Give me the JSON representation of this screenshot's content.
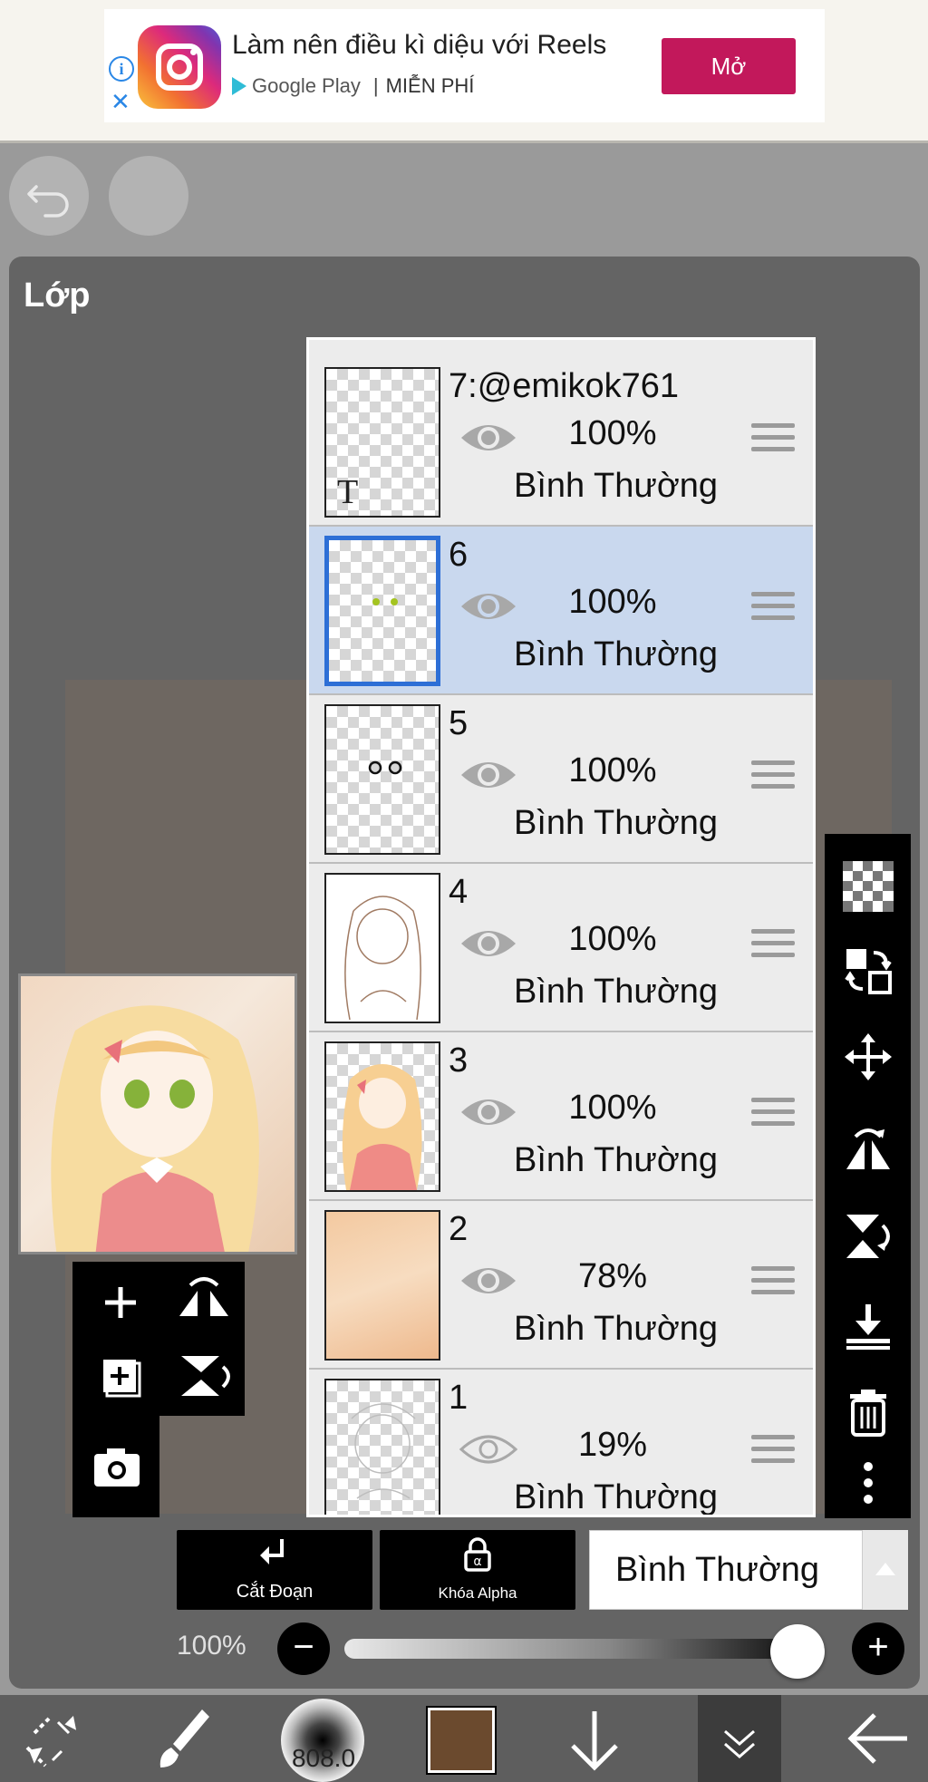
{
  "ad": {
    "title": "Làm nên điều kì diệu với Reels",
    "store": "Google Play",
    "separator": "|",
    "price": "MIỄN PHÍ",
    "cta": "Mở",
    "info_glyph": "i",
    "close_glyph": "✕"
  },
  "panel": {
    "title": "Lớp"
  },
  "layers": [
    {
      "name": "7:@emikok761",
      "opacity": "100%",
      "mode": "Bình Thường",
      "selected": false,
      "visible": true,
      "thumb_glyph": "T"
    },
    {
      "name": "6",
      "opacity": "100%",
      "mode": "Bình Thường",
      "selected": true,
      "visible": true
    },
    {
      "name": "5",
      "opacity": "100%",
      "mode": "Bình Thường",
      "selected": false,
      "visible": true
    },
    {
      "name": "4",
      "opacity": "100%",
      "mode": "Bình Thường",
      "selected": false,
      "visible": true
    },
    {
      "name": "3",
      "opacity": "100%",
      "mode": "Bình Thường",
      "selected": false,
      "visible": true
    },
    {
      "name": "2",
      "opacity": "78%",
      "mode": "Bình Thường",
      "selected": false,
      "visible": true
    },
    {
      "name": "1",
      "opacity": "19%",
      "mode": "Bình Thường",
      "selected": false,
      "visible": false
    }
  ],
  "actions": {
    "clip_label": "Cắt Đoạn",
    "alpha_lock_label": "Khóa Alpha"
  },
  "blend_mode": {
    "selected": "Bình Thường"
  },
  "opacity": {
    "value": "100%",
    "minus": "−",
    "plus": "+",
    "level": 1.0
  },
  "bottom_nav": {
    "brush_size": "808.0"
  },
  "colors": {
    "accent": "#2d6fd6",
    "ad_button": "#c2185b",
    "current_color": "#6b4a2e",
    "selected_row": "#c9d8ee"
  },
  "icons": {
    "right_toolbar": [
      "transparency-icon",
      "layer-transform-icon",
      "move-icon",
      "flip-horizontal-icon",
      "flip-vertical-icon",
      "merge-down-icon",
      "trash-icon",
      "more-icon"
    ],
    "left_toolbar": [
      "add-layer-icon",
      "flip-h-small-icon",
      "add-layer-copy-icon",
      "flip-v-small-icon",
      "camera-icon"
    ],
    "bottom_nav": [
      "selection-transform-icon",
      "brush-icon",
      "brush-size-icon",
      "color-swatch-icon",
      "arrow-down-icon",
      "layers-icon",
      "back-arrow-icon"
    ]
  }
}
